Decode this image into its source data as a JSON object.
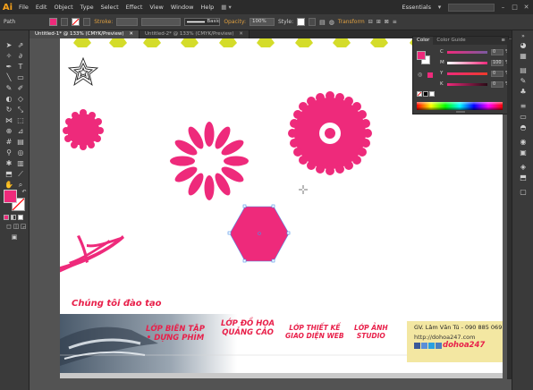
{
  "app": {
    "logo": "Ai",
    "brand_color": "#f7a21b"
  },
  "menu": [
    "File",
    "Edit",
    "Object",
    "Type",
    "Select",
    "Effect",
    "View",
    "Window",
    "Help"
  ],
  "workspace": {
    "name": "Essentials"
  },
  "control_bar": {
    "path_label": "Path",
    "fill_color": "#ee2a7b",
    "stroke_label": "Stroke:",
    "brush_label": "Basic",
    "opacity_label": "Opacity:",
    "opacity_value": "100%",
    "style_label": "Style:",
    "transform_label": "Transform"
  },
  "tabs": [
    {
      "label": "Untitled-1* @ 133% (CMYK/Preview)",
      "active": true
    },
    {
      "label": "Untitled-2* @ 133% (CMYK/Preview)",
      "active": false
    }
  ],
  "color_panel": {
    "tabs": [
      "Color",
      "Color Guide"
    ],
    "fill": "#ee2a7b",
    "channels": [
      {
        "letter": "C",
        "value": "0",
        "unit": "%"
      },
      {
        "letter": "M",
        "value": "100",
        "unit": "%"
      },
      {
        "letter": "Y",
        "value": "0",
        "unit": "%"
      },
      {
        "letter": "K",
        "value": "0",
        "unit": "%"
      }
    ]
  },
  "banner": {
    "heading": "Chúng tôi đào tạo",
    "courses": [
      {
        "line1": "LỚP BIÊN TẬP",
        "line2": "• DỰNG PHIM"
      },
      {
        "line1": "LỚP ĐỒ HỌA",
        "line2": "QUẢNG CÁO"
      },
      {
        "line1": "LỚP THIẾT KẾ",
        "line2": "GIAO DIỆN WEB"
      },
      {
        "line1": "LỚP ẢNH",
        "line2": "STUDIO"
      }
    ],
    "teacher": "GV. Lâm Văn Tú - 090 885 069",
    "website": "http://dohoa247.com",
    "brand": "dohoa247",
    "accent_color": "#e8204a"
  }
}
